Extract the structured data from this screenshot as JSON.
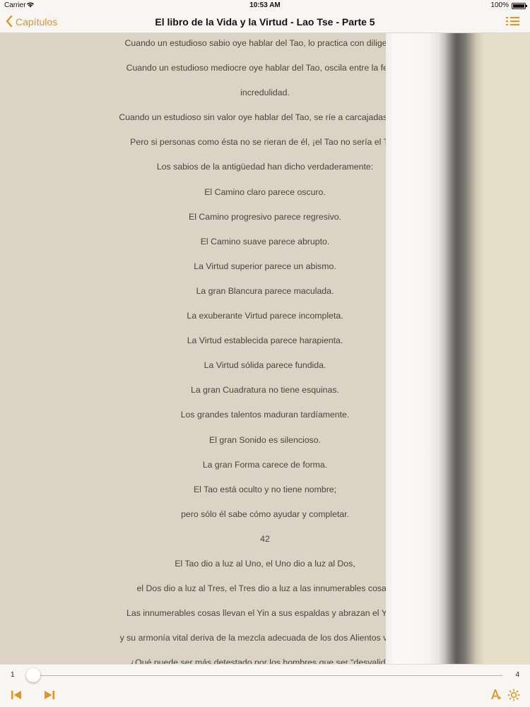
{
  "status": {
    "carrier": "Carrier",
    "time": "10:53 AM",
    "battery": "100%"
  },
  "nav": {
    "back_label": "Capítulos",
    "title": "El libro de la Vida y la Virtud - Lao Tse - Parte 5"
  },
  "page": {
    "lines": [
      "Cuando un estudioso sabio oye hablar del Tao, lo practica con diligencia.",
      "Cuando un estudioso mediocre oye hablar del Tao, oscila entre la fe y la",
      "incredulidad.",
      "Cuando un estudioso sin valor oye hablar del Tao, se ríe a carcajadas de él.",
      "Pero si personas como ésta no se rieran de él, ¡el Tao no sería el Tao!",
      "Los sabios de la antigüedad han dicho verdaderamente:",
      "El Camino claro parece oscuro.",
      "El Camino progresivo parece regresivo.",
      "El Camino suave parece abrupto.",
      "La Virtud superior parece un abismo.",
      "La gran Blancura parece maculada.",
      "La exuberante Virtud parece incompleta.",
      "La Virtud establecida parece harapienta.",
      "La Virtud sólida parece fundida.",
      "La gran Cuadratura no tiene esquinas.",
      "Los grandes talentos maduran tardíamente.",
      "El gran Sonido es silencioso.",
      "La gran Forma carece de forma.",
      "El Tao está oculto y no tiene nombre;",
      "pero sólo él sabe cómo ayudar y completar.",
      "42",
      "El Tao dio a luz al Uno, el Uno dio a luz al Dos,",
      "el Dos dio a luz al Tres, el Tres dio a luz a las innumerables cosas.",
      "Las innumerables cosas llevan el Yin a sus espaldas y abrazan el Yang,",
      "y su armonía vital deriva de la mezcla adecuada de los dos Alientos vitales.",
      "¿Qué puede ser más detestado por los hombres que ser \"desvalidos\","
    ]
  },
  "pager": {
    "current": "1",
    "total": "4",
    "progress": 0.0
  },
  "icons": {
    "wifi": "wifi-icon",
    "back": "chevron-left-icon",
    "list": "list-icon",
    "prev": "skip-back-icon",
    "next": "skip-forward-icon",
    "font": "font-size-icon",
    "brightness": "brightness-icon"
  },
  "colors": {
    "accent": "#e7941d",
    "page_bg": "#dbd3c5",
    "text": "#4a443a"
  }
}
